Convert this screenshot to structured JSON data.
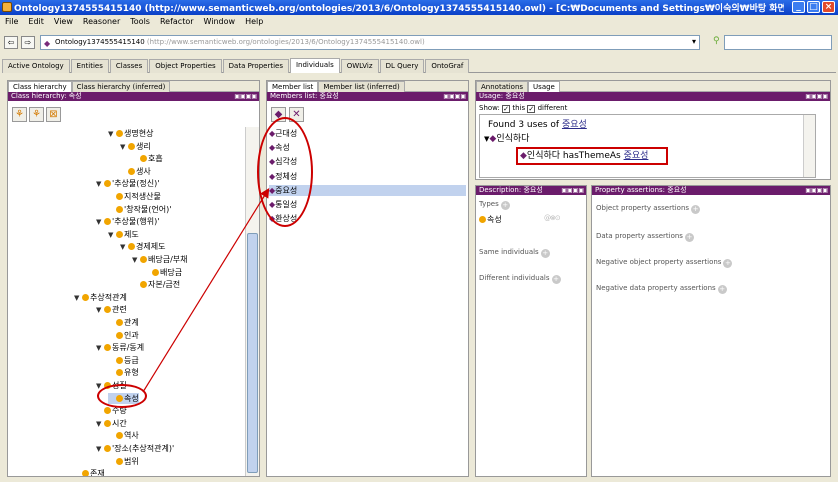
{
  "window": {
    "title": "Ontology1374555415140 (http://www.semanticweb.org/ontologies/2013/6/Ontology1374555415140.owl) - [C:₩Documents and Settings₩이숙의₩바탕 화면₩의미부유...",
    "minimize": "_",
    "maximize": "□",
    "close": "×"
  },
  "menu": [
    "File",
    "Edit",
    "View",
    "Reasoner",
    "Tools",
    "Refactor",
    "Window",
    "Help"
  ],
  "address": {
    "back": "⇦",
    "forward": "⇨",
    "ontology_name": "Ontology1374555415140",
    "url": "(http://www.semanticweb.org/ontologies/2013/6/Ontology1374555415140.owl)",
    "dropdown": "▾",
    "search_icon": "binoculars-icon"
  },
  "tabs": [
    "Active Ontology",
    "Entities",
    "Classes",
    "Object Properties",
    "Data Properties",
    "Individuals",
    "OWLViz",
    "DL Query",
    "OntoGraf"
  ],
  "active_tab": "Individuals",
  "class_panel": {
    "subtabs": [
      "Class hierarchy",
      "Class hierarchy (inferred)"
    ],
    "header": "Class hierarchy: 속성",
    "header_btns": "▣▣▣▣",
    "tree": [
      {
        "label": "생명현상",
        "level": 2,
        "expander": "▼"
      },
      {
        "label": "생리",
        "level": 3,
        "expander": "▼"
      },
      {
        "label": "호흡",
        "level": 4,
        "expander": ""
      },
      {
        "label": "생사",
        "level": 3,
        "expander": ""
      },
      {
        "label": "'추상물(정신)'",
        "level": 1,
        "expander": "▼"
      },
      {
        "label": "지적생산물",
        "level": 2,
        "expander": ""
      },
      {
        "label": "'창작물(언어)'",
        "level": 2,
        "expander": ""
      },
      {
        "label": "'추상물(행위)'",
        "level": 1,
        "expander": "▼"
      },
      {
        "label": "제도",
        "level": 2,
        "expander": "▼"
      },
      {
        "label": "경제제도",
        "level": 3,
        "expander": "▼"
      },
      {
        "label": "배당금/부채",
        "level": 4,
        "expander": "▼"
      },
      {
        "label": "배당금",
        "level": 5,
        "expander": ""
      },
      {
        "label": "자본/금전",
        "level": 4,
        "expander": ""
      },
      {
        "label": "추상적관계",
        "level": 0,
        "expander": "▼"
      },
      {
        "label": "관련",
        "level": 1,
        "expander": "▼"
      },
      {
        "label": "관계",
        "level": 2,
        "expander": ""
      },
      {
        "label": "인과",
        "level": 2,
        "expander": ""
      },
      {
        "label": "동류/동계",
        "level": 1,
        "expander": "▼"
      },
      {
        "label": "등급",
        "level": 2,
        "expander": ""
      },
      {
        "label": "유형",
        "level": 2,
        "expander": ""
      },
      {
        "label": "성질",
        "level": 1,
        "expander": "▼"
      },
      {
        "label": "속성",
        "level": 2,
        "expander": "",
        "selected": true
      },
      {
        "label": "수량",
        "level": 1,
        "expander": ""
      },
      {
        "label": "시간",
        "level": 1,
        "expander": "▼"
      },
      {
        "label": "역사",
        "level": 2,
        "expander": ""
      },
      {
        "label": "'장소(추상적관계)'",
        "level": 1,
        "expander": "▼"
      },
      {
        "label": "범위",
        "level": 2,
        "expander": ""
      },
      {
        "label": "존재",
        "level": 0,
        "expander": ""
      }
    ]
  },
  "members_panel": {
    "subtabs": [
      "Member list",
      "Member list (inferred)"
    ],
    "header": "Members list: 중요성",
    "header_btns": "▣▣▣▣",
    "items": [
      "근대성",
      "속성",
      "심각성",
      "정체성",
      "중요성",
      "통일성",
      "환상성"
    ],
    "selected_index": 4
  },
  "usage_panel": {
    "subtabs": [
      "Annotations",
      "Usage"
    ],
    "header": "Usage: 중요성",
    "header_btns": "▣▣▣▣",
    "show_label": "Show:",
    "this_label": "this",
    "different_label": "different",
    "found_text": "Found 3 uses of ",
    "found_target": "중요성",
    "tree_parent": "인식하다",
    "tree_child_prefix": "인식하다 hasThemeAs ",
    "tree_child_target": "중요성"
  },
  "description_panel": {
    "header": "Description: 중요성",
    "header_btns": "▣▣▣▣",
    "types_label": "Types",
    "type_value": "속성",
    "same_label": "Same individuals",
    "different_label": "Different individuals"
  },
  "property_panel": {
    "header": "Property assertions: 중요성",
    "header_btns": "▣▣▣▣",
    "sections": [
      "Object property assertions",
      "Data property assertions",
      "Negative object property assertions",
      "Negative data property assertions"
    ]
  },
  "colors": {
    "header": "#6b1c6b",
    "annotation": "#cc0000",
    "selection": "#c1d2ee"
  }
}
